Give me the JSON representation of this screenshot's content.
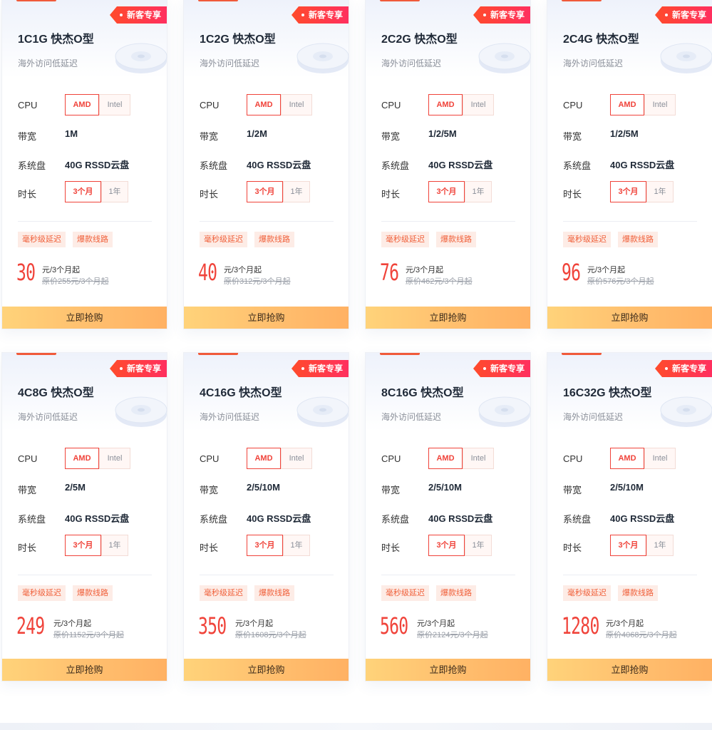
{
  "labels": {
    "cpu": "CPU",
    "bandwidth": "带宽",
    "disk": "系统盘",
    "duration": "时长"
  },
  "colors": {
    "accent": "#f0433a",
    "badge": "#ff4b2b",
    "buy_button": "#ffc06f"
  },
  "cards": [
    {
      "title": "1C1G 快杰O型",
      "subtitle": "海外访问低延迟",
      "badge": "新客专享",
      "cpu_options": [
        "AMD",
        "Intel"
      ],
      "cpu_selected": "AMD",
      "bandwidth": "1M",
      "disk": "40G RSSD云盘",
      "duration_options": [
        "3个月",
        "1年"
      ],
      "duration_selected": "3个月",
      "tags": [
        "毫秒级延迟",
        "爆款线路"
      ],
      "price": "30",
      "price_unit": "元/3个月起",
      "original_price": "原价255元/3个月起",
      "buy_label": "立即抢购"
    },
    {
      "title": "1C2G 快杰O型",
      "subtitle": "海外访问低延迟",
      "badge": "新客专享",
      "cpu_options": [
        "AMD",
        "Intel"
      ],
      "cpu_selected": "AMD",
      "bandwidth": "1/2M",
      "disk": "40G RSSD云盘",
      "duration_options": [
        "3个月",
        "1年"
      ],
      "duration_selected": "3个月",
      "tags": [
        "毫秒级延迟",
        "爆款线路"
      ],
      "price": "40",
      "price_unit": "元/3个月起",
      "original_price": "原价312元/3个月起",
      "buy_label": "立即抢购"
    },
    {
      "title": "2C2G 快杰O型",
      "subtitle": "海外访问低延迟",
      "badge": "新客专享",
      "cpu_options": [
        "AMD",
        "Intel"
      ],
      "cpu_selected": "AMD",
      "bandwidth": "1/2/5M",
      "disk": "40G RSSD云盘",
      "duration_options": [
        "3个月",
        "1年"
      ],
      "duration_selected": "3个月",
      "tags": [
        "毫秒级延迟",
        "爆款线路"
      ],
      "price": "76",
      "price_unit": "元/3个月起",
      "original_price": "原价462元/3个月起",
      "buy_label": "立即抢购"
    },
    {
      "title": "2C4G 快杰O型",
      "subtitle": "海外访问低延迟",
      "badge": "新客专享",
      "cpu_options": [
        "AMD",
        "Intel"
      ],
      "cpu_selected": "AMD",
      "bandwidth": "1/2/5M",
      "disk": "40G RSSD云盘",
      "duration_options": [
        "3个月",
        "1年"
      ],
      "duration_selected": "3个月",
      "tags": [
        "毫秒级延迟",
        "爆款线路"
      ],
      "price": "96",
      "price_unit": "元/3个月起",
      "original_price": "原价576元/3个月起",
      "buy_label": "立即抢购"
    },
    {
      "title": "4C8G 快杰O型",
      "subtitle": "海外访问低延迟",
      "badge": "新客专享",
      "cpu_options": [
        "AMD",
        "Intel"
      ],
      "cpu_selected": "AMD",
      "bandwidth": "2/5M",
      "disk": "40G RSSD云盘",
      "duration_options": [
        "3个月",
        "1年"
      ],
      "duration_selected": "3个月",
      "tags": [
        "毫秒级延迟",
        "爆款线路"
      ],
      "price": "249",
      "price_unit": "元/3个月起",
      "original_price": "原价1152元/3个月起",
      "buy_label": "立即抢购"
    },
    {
      "title": "4C16G 快杰O型",
      "subtitle": "海外访问低延迟",
      "badge": "新客专享",
      "cpu_options": [
        "AMD",
        "Intel"
      ],
      "cpu_selected": "AMD",
      "bandwidth": "2/5/10M",
      "disk": "40G RSSD云盘",
      "duration_options": [
        "3个月",
        "1年"
      ],
      "duration_selected": "3个月",
      "tags": [
        "毫秒级延迟",
        "爆款线路"
      ],
      "price": "350",
      "price_unit": "元/3个月起",
      "original_price": "原价1608元/3个月起",
      "buy_label": "立即抢购"
    },
    {
      "title": "8C16G 快杰O型",
      "subtitle": "海外访问低延迟",
      "badge": "新客专享",
      "cpu_options": [
        "AMD",
        "Intel"
      ],
      "cpu_selected": "AMD",
      "bandwidth": "2/5/10M",
      "disk": "40G RSSD云盘",
      "duration_options": [
        "3个月",
        "1年"
      ],
      "duration_selected": "3个月",
      "tags": [
        "毫秒级延迟",
        "爆款线路"
      ],
      "price": "560",
      "price_unit": "元/3个月起",
      "original_price": "原价2124元/3个月起",
      "buy_label": "立即抢购"
    },
    {
      "title": "16C32G 快杰O型",
      "subtitle": "海外访问低延迟",
      "badge": "新客专享",
      "cpu_options": [
        "AMD",
        "Intel"
      ],
      "cpu_selected": "AMD",
      "bandwidth": "2/5/10M",
      "disk": "40G RSSD云盘",
      "duration_options": [
        "3个月",
        "1年"
      ],
      "duration_selected": "3个月",
      "tags": [
        "毫秒级延迟",
        "爆款线路"
      ],
      "price": "1280",
      "price_unit": "元/3个月起",
      "original_price": "原价4068元/3个月起",
      "buy_label": "立即抢购"
    }
  ]
}
